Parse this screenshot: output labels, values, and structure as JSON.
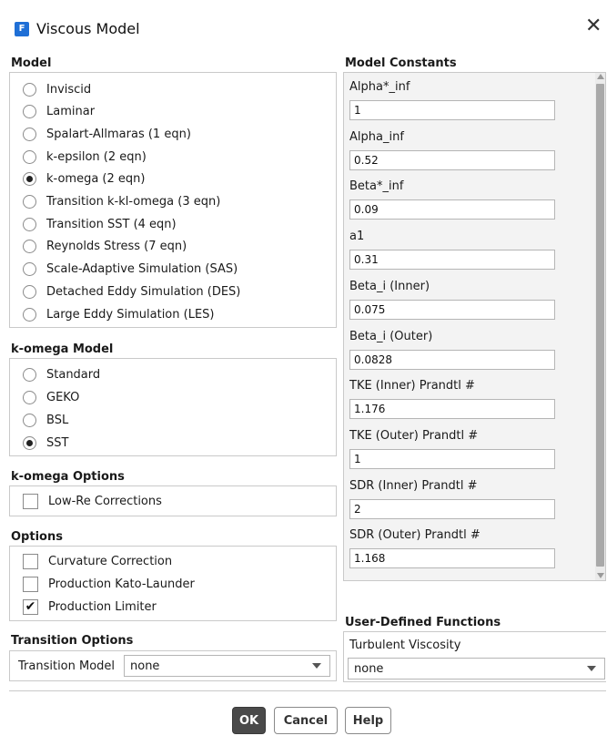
{
  "window": {
    "title": "Viscous Model",
    "logo_letter": "F"
  },
  "model": {
    "label": "Model",
    "options": [
      {
        "label": "Inviscid",
        "selected": false
      },
      {
        "label": "Laminar",
        "selected": false
      },
      {
        "label": "Spalart-Allmaras (1 eqn)",
        "selected": false
      },
      {
        "label": "k-epsilon (2 eqn)",
        "selected": false
      },
      {
        "label": "k-omega (2 eqn)",
        "selected": true
      },
      {
        "label": "Transition k-kl-omega (3 eqn)",
        "selected": false
      },
      {
        "label": "Transition SST (4 eqn)",
        "selected": false
      },
      {
        "label": "Reynolds Stress (7 eqn)",
        "selected": false
      },
      {
        "label": "Scale-Adaptive Simulation (SAS)",
        "selected": false
      },
      {
        "label": "Detached Eddy Simulation (DES)",
        "selected": false
      },
      {
        "label": "Large Eddy Simulation (LES)",
        "selected": false
      }
    ]
  },
  "komega_model": {
    "label": "k-omega Model",
    "options": [
      {
        "label": "Standard",
        "selected": false
      },
      {
        "label": "GEKO",
        "selected": false
      },
      {
        "label": "BSL",
        "selected": false
      },
      {
        "label": "SST",
        "selected": true
      }
    ]
  },
  "komega_options": {
    "label": "k-omega Options",
    "items": [
      {
        "label": "Low-Re Corrections",
        "checked": false
      }
    ]
  },
  "options": {
    "label": "Options",
    "items": [
      {
        "label": "Curvature Correction",
        "checked": false
      },
      {
        "label": "Production Kato-Launder",
        "checked": false
      },
      {
        "label": "Production Limiter",
        "checked": true
      }
    ]
  },
  "transition_options": {
    "label": "Transition Options",
    "model_label": "Transition Model",
    "model_value": "none"
  },
  "model_constants": {
    "label": "Model Constants",
    "items": [
      {
        "label": "Alpha*_inf",
        "value": "1"
      },
      {
        "label": "Alpha_inf",
        "value": "0.52"
      },
      {
        "label": "Beta*_inf",
        "value": "0.09"
      },
      {
        "label": "a1",
        "value": "0.31"
      },
      {
        "label": "Beta_i (Inner)",
        "value": "0.075"
      },
      {
        "label": "Beta_i (Outer)",
        "value": "0.0828"
      },
      {
        "label": "TKE (Inner) Prandtl #",
        "value": "1.176"
      },
      {
        "label": "TKE (Outer) Prandtl #",
        "value": "1"
      },
      {
        "label": "SDR (Inner) Prandtl #",
        "value": "2"
      },
      {
        "label": "SDR (Outer) Prandtl #",
        "value": "1.168"
      }
    ]
  },
  "udf": {
    "label": "User-Defined Functions",
    "turbulent_viscosity_label": "Turbulent Viscosity",
    "turbulent_viscosity_value": "none"
  },
  "buttons": {
    "ok": "OK",
    "cancel": "Cancel",
    "help": "Help"
  },
  "icons": {
    "close": "close-icon",
    "dropdown": "chevron-down-icon",
    "check": "checkmark-icon"
  },
  "colors": {
    "primary_button": "#4a4a4a",
    "logo": "#1f6fd6",
    "panel_bg": "#f3f3f3"
  }
}
